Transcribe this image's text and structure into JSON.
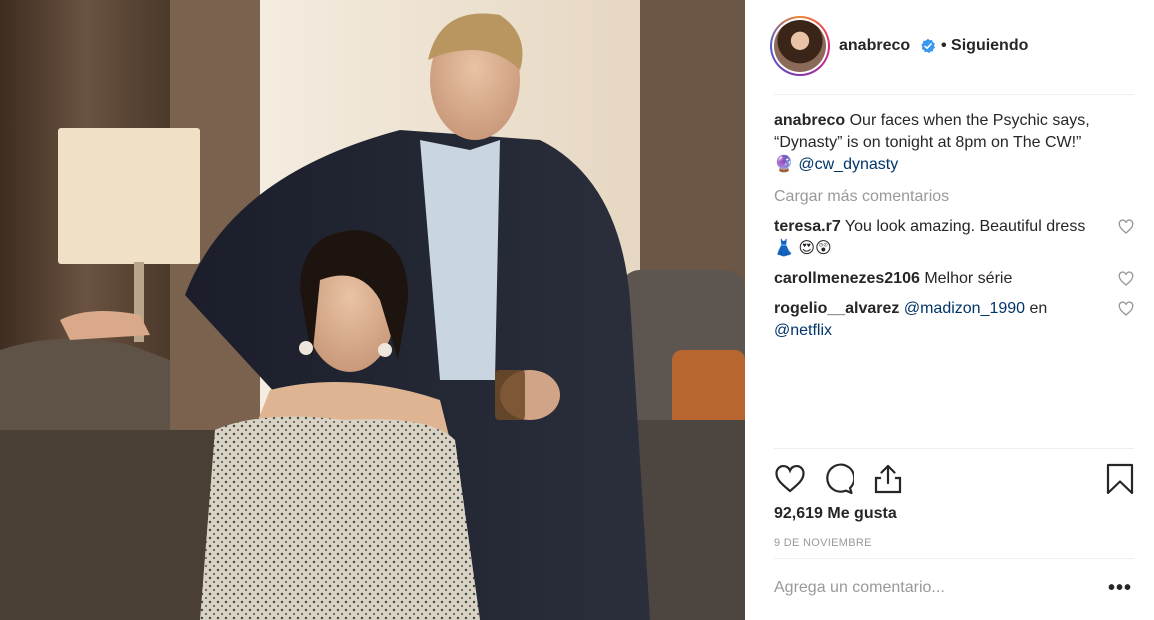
{
  "post": {
    "username": "anabreco",
    "following": "• Siguiendo",
    "caption": {
      "username": "anabreco",
      "text": "Our faces when the Psychic says, “Dynasty” is on tonight at 8pm on The CW!”",
      "emoji": "🔮",
      "mention": "@cw_dynasty"
    },
    "load_more": "Cargar más comentarios",
    "comments": [
      {
        "username": "teresa.r7",
        "text": "You look amazing. Beautiful dress",
        "emoji": "👗 😍😲"
      },
      {
        "username": "carollmenezes2106",
        "text": "Melhor série"
      },
      {
        "username": "rogelio__alvarez",
        "mention1": "@madizon_1990",
        "text": "en",
        "mention2": "@netflix"
      }
    ],
    "likes": "92,619 Me gusta",
    "date": "9 DE NOVIEMBRE",
    "comment_placeholder": "Agrega un comentario...",
    "more_label": "•••"
  },
  "icons": {
    "like": "heart-icon",
    "comment": "comment-bubble-icon",
    "share": "share-icon",
    "save": "bookmark-icon",
    "verified": "verified-badge-icon"
  },
  "colors": {
    "link": "#003569",
    "verified": "#3897f0",
    "muted": "#999999"
  }
}
